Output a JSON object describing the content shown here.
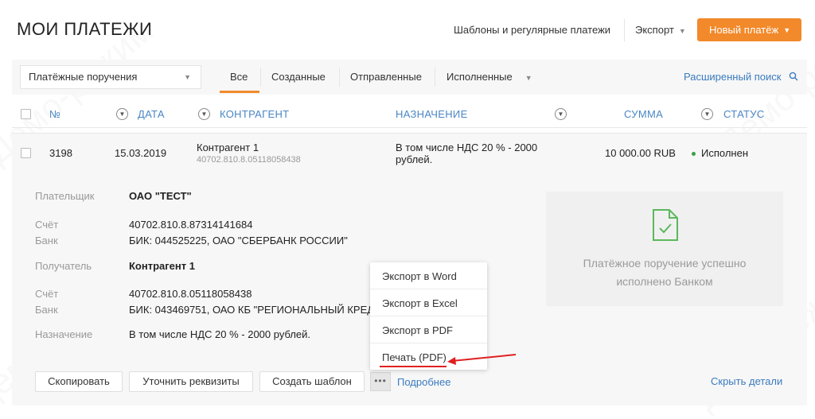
{
  "header": {
    "title": "МОИ ПЛАТЕЖИ",
    "templates_link": "Шаблоны и регулярные платежи",
    "export_label": "Экспорт",
    "new_payment_label": "Новый платёж"
  },
  "filters": {
    "doc_type": "Платёжные поручения",
    "tabs": [
      "Все",
      "Созданные",
      "Отправленные",
      "Исполненные"
    ],
    "active_tab": "Все",
    "advanced_search": "Расширенный поиск"
  },
  "table": {
    "columns": {
      "number": "№",
      "date": "ДАТА",
      "counterparty": "КОНТРАГЕНТ",
      "purpose": "НАЗНАЧЕНИЕ",
      "amount": "СУММА",
      "status": "СТАТУС"
    },
    "rows": [
      {
        "number": "3198",
        "date": "15.03.2019",
        "counterparty": "Контрагент 1",
        "account": "40702.810.8.05118058438",
        "purpose_line1": "В том числе НДС 20 % - 2000",
        "purpose_line2": "рублей.",
        "amount": "10 000.00 RUB",
        "status": "Исполнен"
      }
    ]
  },
  "details": {
    "payer_label": "Плательщик",
    "payer_value": "ОАО \"ТЕСТ\"",
    "account_label": "Счёт",
    "payer_account": "40702.810.8.87314141684",
    "bank_label": "Банк",
    "payer_bank": "БИК: 044525225, ОАО \"СБЕРБАНК РОССИИ\"",
    "recipient_label": "Получатель",
    "recipient_value": "Контрагент 1",
    "recipient_account": "40702.810.8.05118058438",
    "recipient_bank": "БИК: 043469751, ОАО КБ \"РЕГИОНАЛЬНЫЙ КРЕДИ",
    "purpose_label": "Назначение",
    "purpose_value": "В том числе НДС 20 % - 2000 рублей.",
    "status_message_line1": "Платёжное поручение успешно",
    "status_message_line2": "исполнено Банком"
  },
  "actions": {
    "copy": "Скопировать",
    "clarify": "Уточнить реквизиты",
    "create_template": "Создать шаблон",
    "more_dots": "•••",
    "more_link": "Подробнее",
    "hide_details": "Скрыть детали"
  },
  "export_menu": {
    "items": [
      "Экспорт в Word",
      "Экспорт в Excel",
      "Экспорт в PDF",
      "Печать (PDF)"
    ]
  },
  "watermark": "Демо-режим",
  "colors": {
    "accent": "#f2892a",
    "link": "#3a7bbf",
    "status_ok": "#3aa046",
    "annotation": "#e02020"
  }
}
